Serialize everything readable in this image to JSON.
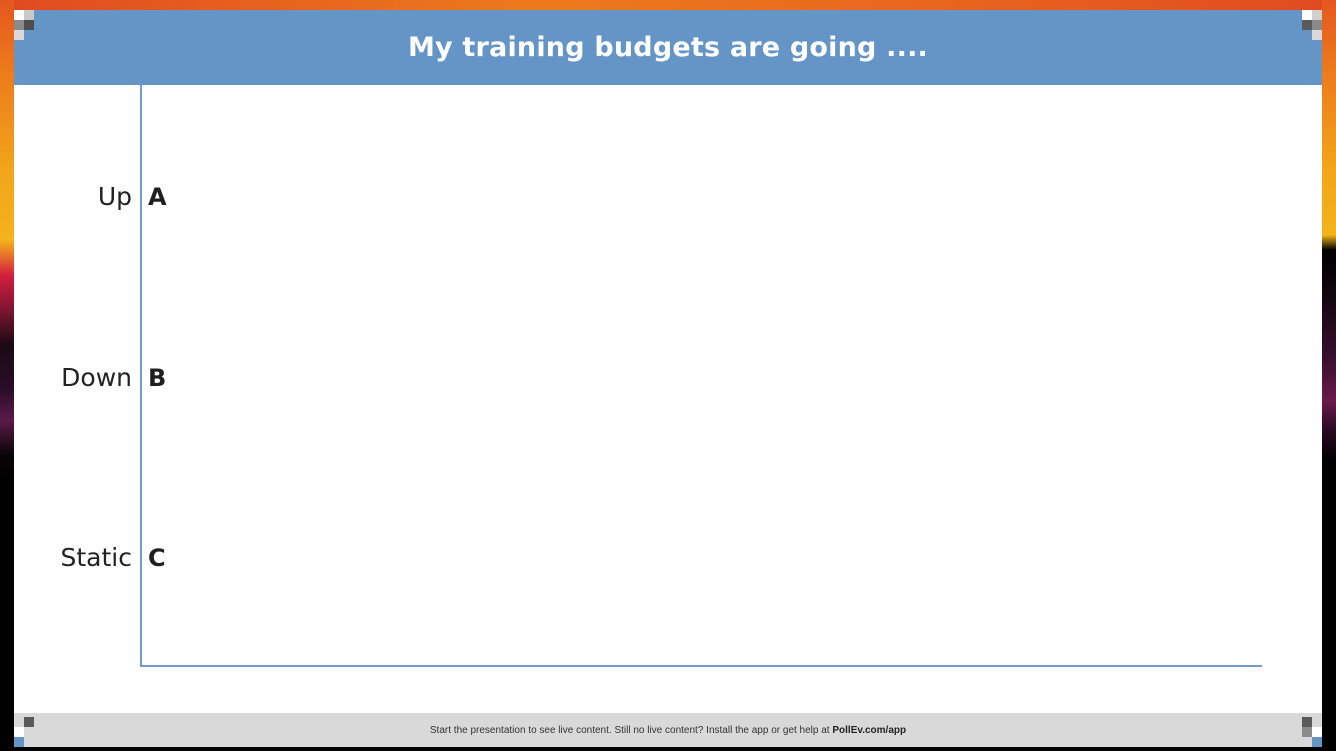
{
  "slide": {
    "title": "My training budgets are going ....",
    "options": [
      {
        "label": "Up",
        "letter": "A"
      },
      {
        "label": "Down",
        "letter": "B"
      },
      {
        "label": "Static",
        "letter": "C"
      }
    ]
  },
  "footer": {
    "text": "Start the presentation to see live content. Still no live content? Install the app or get help at ",
    "link": "PollEv.com/app"
  },
  "colors": {
    "title_bar": "#6595c7",
    "axis": "#6f9bd0",
    "footer_bar": "#d9d9d9"
  },
  "chart_data": {
    "type": "bar",
    "categories": [
      "Up",
      "Down",
      "Static"
    ],
    "category_keys": [
      "A",
      "B",
      "C"
    ],
    "series": [],
    "title": "My training budgets are going ....",
    "grid": false
  }
}
